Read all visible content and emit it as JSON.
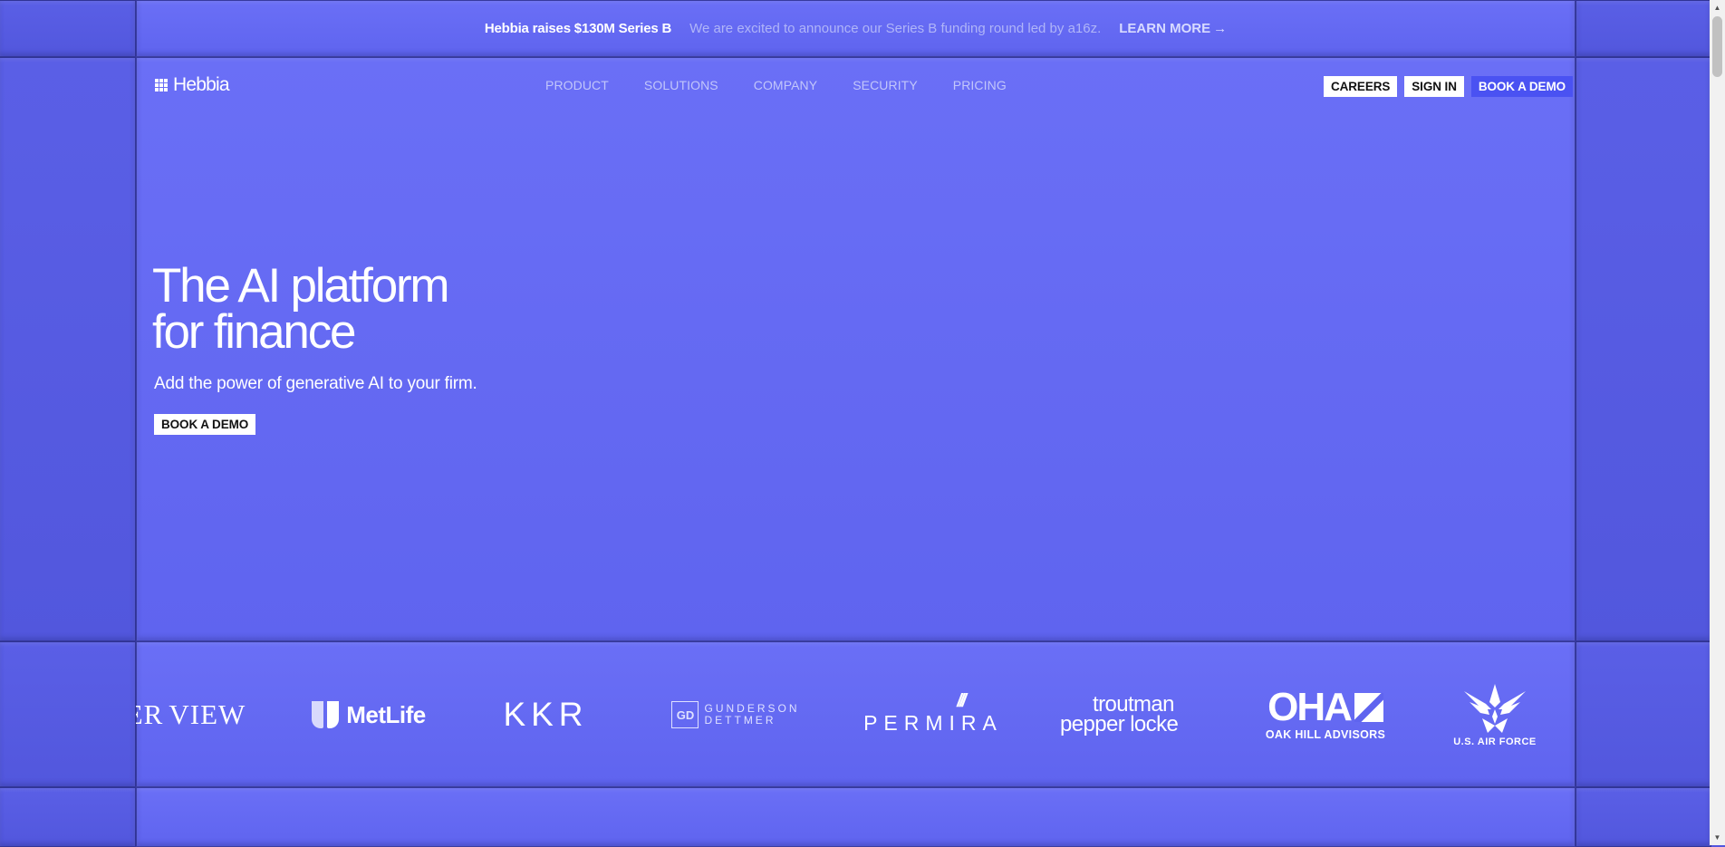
{
  "announcement": {
    "title": "Hebbia raises $130M Series B",
    "text": "We are excited to announce our Series B funding round led by a16z.",
    "link": "LEARN MORE",
    "link_icon": "arrow-right-icon"
  },
  "header": {
    "brand": "Hebbia",
    "nav": [
      "PRODUCT",
      "SOLUTIONS",
      "COMPANY",
      "SECURITY",
      "PRICING"
    ],
    "careers": "CAREERS",
    "sign_in": "SIGN IN",
    "book_demo": "BOOK A DEMO"
  },
  "hero": {
    "title_line1": "The AI platform",
    "title_line2": "for finance",
    "subtitle": "Add the power of generative AI to your firm.",
    "cta": "BOOK A DEMO"
  },
  "customers": {
    "riverview_left": "ER",
    "riverview_right": "VIEW",
    "metlife": "MetLife",
    "kkr": "KKR",
    "gunderson_mark": "GD",
    "gunderson_line1": "GUNDERSON",
    "gunderson_line2": "DETTMER",
    "permira": "PERMIRA",
    "troutman_line1": "troutman",
    "troutman_line2": "pepper locke",
    "oha": "OHA",
    "oha_sub": "OAK HILL ADVISORS",
    "usaf": "U.S. AIR FORCE"
  },
  "colors": {
    "background": "#5f64ef",
    "accent_button": "#4a52f2"
  }
}
